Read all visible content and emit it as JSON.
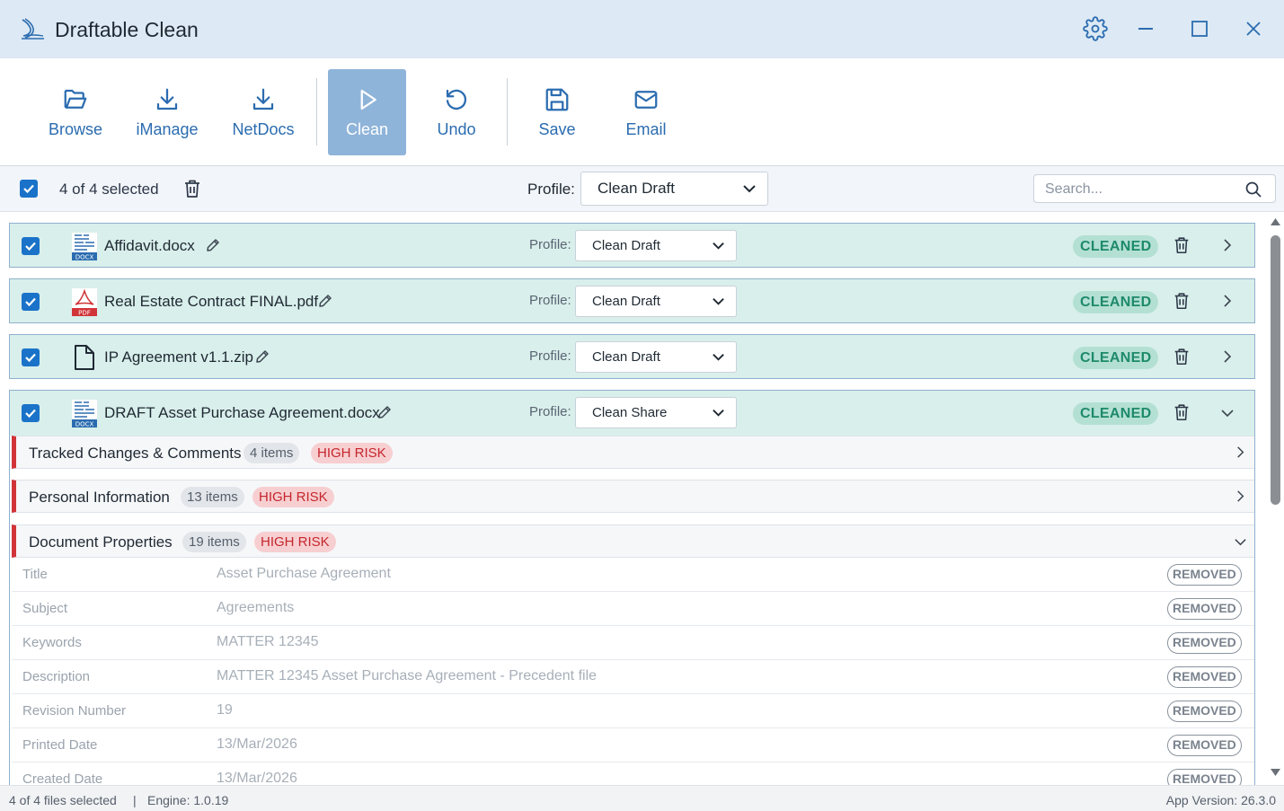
{
  "window": {
    "title": "Draftable Clean"
  },
  "toolbar": {
    "browse": "Browse",
    "imanage": "iManage",
    "netdocs": "NetDocs",
    "clean": "Clean",
    "undo": "Undo",
    "save": "Save",
    "email": "Email"
  },
  "selection": {
    "count_text": "4 of 4 selected",
    "profile_label": "Profile:",
    "profile_value": "Clean Draft",
    "search_placeholder": "Search..."
  },
  "files": [
    {
      "name": "Affidavit.docx",
      "icon": "docx-icon",
      "profile_label": "Profile:",
      "profile": "Clean Draft",
      "status": "CLEANED"
    },
    {
      "name": "Real Estate Contract FINAL.pdf",
      "icon": "pdf-icon",
      "profile_label": "Profile:",
      "profile": "Clean Draft",
      "status": "CLEANED"
    },
    {
      "name": "IP Agreement v1.1.zip",
      "icon": "file-icon",
      "profile_label": "Profile:",
      "profile": "Clean Draft",
      "status": "CLEANED"
    },
    {
      "name": "DRAFT Asset Purchase Agreement.docx",
      "icon": "docx-icon",
      "profile_label": "Profile:",
      "profile": "Clean Share",
      "status": "CLEANED"
    }
  ],
  "sections": [
    {
      "title": "Tracked Changes & Comments",
      "count": "4 items",
      "risk": "HIGH RISK"
    },
    {
      "title": "Personal Information",
      "count": "13 items",
      "risk": "HIGH RISK"
    },
    {
      "title": "Document Properties",
      "count": "19 items",
      "risk": "HIGH RISK"
    }
  ],
  "properties": [
    {
      "key": "Title",
      "value": "Asset Purchase Agreement",
      "status": "REMOVED"
    },
    {
      "key": "Subject",
      "value": "Agreements",
      "status": "REMOVED"
    },
    {
      "key": "Keywords",
      "value": "MATTER 12345",
      "status": "REMOVED"
    },
    {
      "key": "Description",
      "value": "MATTER 12345 Asset Purchase Agreement - Precedent file",
      "status": "REMOVED"
    },
    {
      "key": "Revision Number",
      "value": "19",
      "status": "REMOVED"
    },
    {
      "key": "Printed Date",
      "value": "13/Mar/2026",
      "status": "REMOVED"
    },
    {
      "key": "Created Date",
      "value": "13/Mar/2026",
      "status": "REMOVED"
    }
  ],
  "status_bar": {
    "files_selected": "4 of 4 files selected",
    "separator": "|",
    "engine": "Engine: 1.0.19",
    "app_version": "App Version: 26.3.0"
  },
  "colors": {
    "accent": "#1a73c9",
    "toolbar_text": "#2b6cb0",
    "cleaned_bg": "#b4e0d4",
    "cleaned_text": "#1e8a6a",
    "risk_bg": "#f7cfd1",
    "risk_text": "#c4262c",
    "row_bg": "#d9efeb"
  }
}
